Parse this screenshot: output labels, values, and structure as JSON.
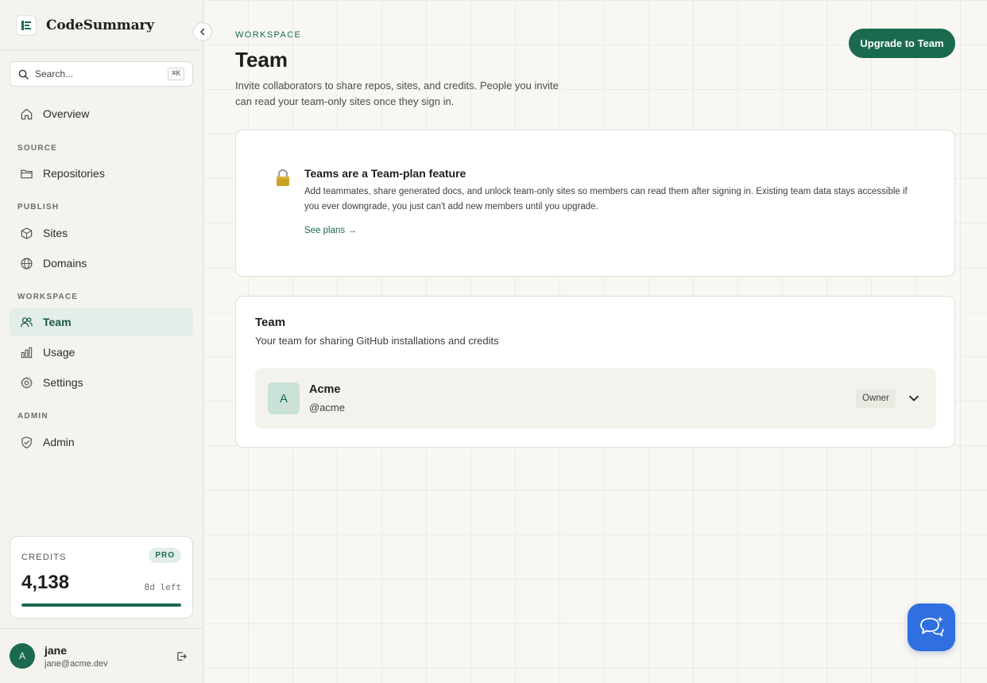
{
  "brand": {
    "name": "CodeSummary"
  },
  "search": {
    "placeholder": "Search...",
    "shortcut": "⌘K"
  },
  "sidebar": {
    "overview": "Overview",
    "sections": {
      "source": "SOURCE",
      "publish": "PUBLISH",
      "workspace": "WORKSPACE",
      "admin": "ADMIN"
    },
    "items": [
      {
        "label": "Repositories",
        "icon": "folder-icon"
      },
      {
        "label": "Sites",
        "icon": "cube-icon"
      },
      {
        "label": "Domains",
        "icon": "globe-icon"
      },
      {
        "label": "Team",
        "icon": "users-icon",
        "active": true
      },
      {
        "label": "Usage",
        "icon": "bar-chart-icon"
      },
      {
        "label": "Settings",
        "icon": "gear-icon"
      },
      {
        "label": "Admin",
        "icon": "shield-check-icon"
      }
    ]
  },
  "credits": {
    "label": "CREDITS",
    "plan": "PRO",
    "value": "4,138",
    "time_left": "8d left",
    "progress_fraction": 1.0
  },
  "user": {
    "initial": "A",
    "name": "jane",
    "email": "jane@acme.dev"
  },
  "header": {
    "eyebrow": "WORKSPACE",
    "title": "Team",
    "description": "Invite collaborators to share repos, sites, and credits. People you invite can read your team-only sites once they sign in.",
    "upgrade_label": "Upgrade to Team"
  },
  "gate": {
    "title": "Teams are a Team-plan feature",
    "body": "Add teammates, share generated docs, and unlock team-only sites so members can read them after signing in. Existing team data stays accessible if you ever downgrade, you just can't add new members until you upgrade.",
    "link": "See plans →"
  },
  "team": {
    "title": "Team",
    "subtitle": "Your team for sharing GitHub installations and credits",
    "entry": {
      "initial": "A",
      "name": "Acme",
      "handle": "@acme",
      "role": "Owner"
    }
  },
  "colors": {
    "accent": "#1a6a4f",
    "active_bg": "#e2eee7",
    "chat": "#2f6fe0"
  }
}
